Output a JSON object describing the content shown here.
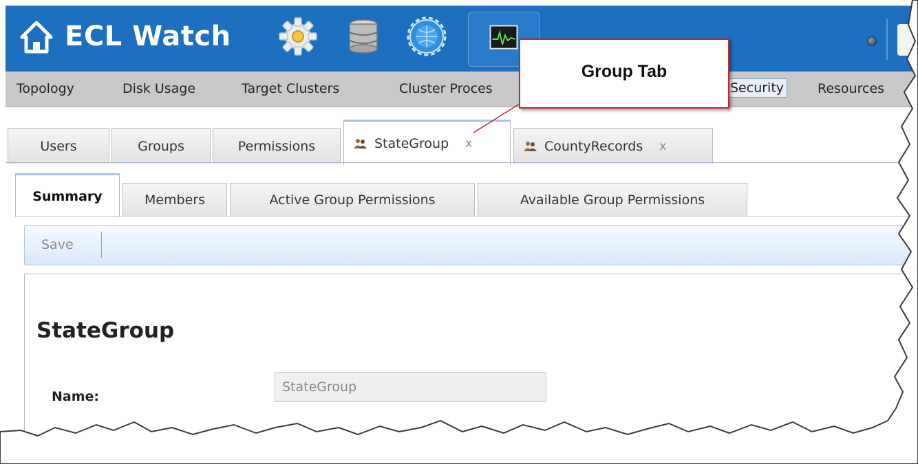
{
  "app": {
    "title": "ECL Watch"
  },
  "nav": {
    "items": [
      "Topology",
      "Disk Usage",
      "Target Clusters",
      "Cluster Proces",
      "Security",
      "Resources"
    ],
    "selected": "Security"
  },
  "tabs": {
    "items": [
      "Users",
      "Groups",
      "Permissions",
      "StateGroup",
      "CountyRecords"
    ],
    "active": "StateGroup",
    "close_glyph": "x"
  },
  "subtabs": {
    "items": [
      "Summary",
      "Members",
      "Active Group Permissions",
      "Available Group Permissions"
    ],
    "active": "Summary"
  },
  "toolbar": {
    "save_label": "Save"
  },
  "summary": {
    "heading": "StateGroup",
    "name_label": "Name:",
    "name_value": "StateGroup"
  },
  "callout": {
    "text": "Group Tab"
  },
  "icons": {
    "home": "home-icon",
    "operations": "gear-icon",
    "files": "database-icon",
    "dfu": "globe-icon",
    "monitor": "monitor-icon",
    "status": "status-dot-icon",
    "group": "group-icon"
  },
  "colors": {
    "appbar": "#1d6fc0",
    "navbar": "#c9c9c9",
    "callout_border": "#c1272d",
    "toolbar_top": "#f4f9fe",
    "toolbar_bottom": "#d9e9f8"
  }
}
